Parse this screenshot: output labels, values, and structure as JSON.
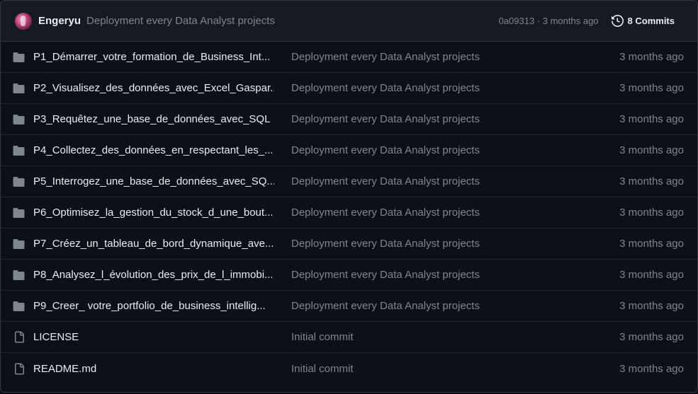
{
  "header": {
    "author": "Engeryu",
    "commit_message": "Deployment every Data Analyst projects",
    "sha_and_time": "0a09313 · 3 months ago",
    "commits_label": "8 Commits"
  },
  "files": [
    {
      "type": "folder",
      "name": "P1_Démarrer_votre_formation_de_Business_Int...",
      "message": "Deployment every Data Analyst projects",
      "age": "3 months ago"
    },
    {
      "type": "folder",
      "name": "P2_Visualisez_des_données_avec_Excel_Gaspar...",
      "message": "Deployment every Data Analyst projects",
      "age": "3 months ago"
    },
    {
      "type": "folder",
      "name": "P3_Requêtez_une_base_de_données_avec_SQL",
      "message": "Deployment every Data Analyst projects",
      "age": "3 months ago"
    },
    {
      "type": "folder",
      "name": "P4_Collectez_des_données_en_respectant_les_...",
      "message": "Deployment every Data Analyst projects",
      "age": "3 months ago"
    },
    {
      "type": "folder",
      "name": "P5_Interrogez_une_base_de_données_avec_SQ...",
      "message": "Deployment every Data Analyst projects",
      "age": "3 months ago"
    },
    {
      "type": "folder",
      "name": "P6_Optimisez_la_gestion_du_stock_d_une_bout...",
      "message": "Deployment every Data Analyst projects",
      "age": "3 months ago"
    },
    {
      "type": "folder",
      "name": "P7_Créez_un_tableau_de_bord_dynamique_ave...",
      "message": "Deployment every Data Analyst projects",
      "age": "3 months ago"
    },
    {
      "type": "folder",
      "name": "P8_Analysez_l_évolution_des_prix_de_l_immobi...",
      "message": "Deployment every Data Analyst projects",
      "age": "3 months ago"
    },
    {
      "type": "folder",
      "name": "P9_Creer_ votre_portfolio_de_business_intellig...",
      "message": "Deployment every Data Analyst projects",
      "age": "3 months ago"
    },
    {
      "type": "file",
      "name": "LICENSE",
      "message": "Initial commit",
      "age": "3 months ago"
    },
    {
      "type": "file",
      "name": "README.md",
      "message": "Initial commit",
      "age": "3 months ago"
    }
  ],
  "colors": {
    "background": "#0d1117",
    "header_background": "#161b22",
    "border": "#30363d",
    "text": "#e6edf3",
    "muted": "#7d8590",
    "icon": "#7d8590"
  }
}
